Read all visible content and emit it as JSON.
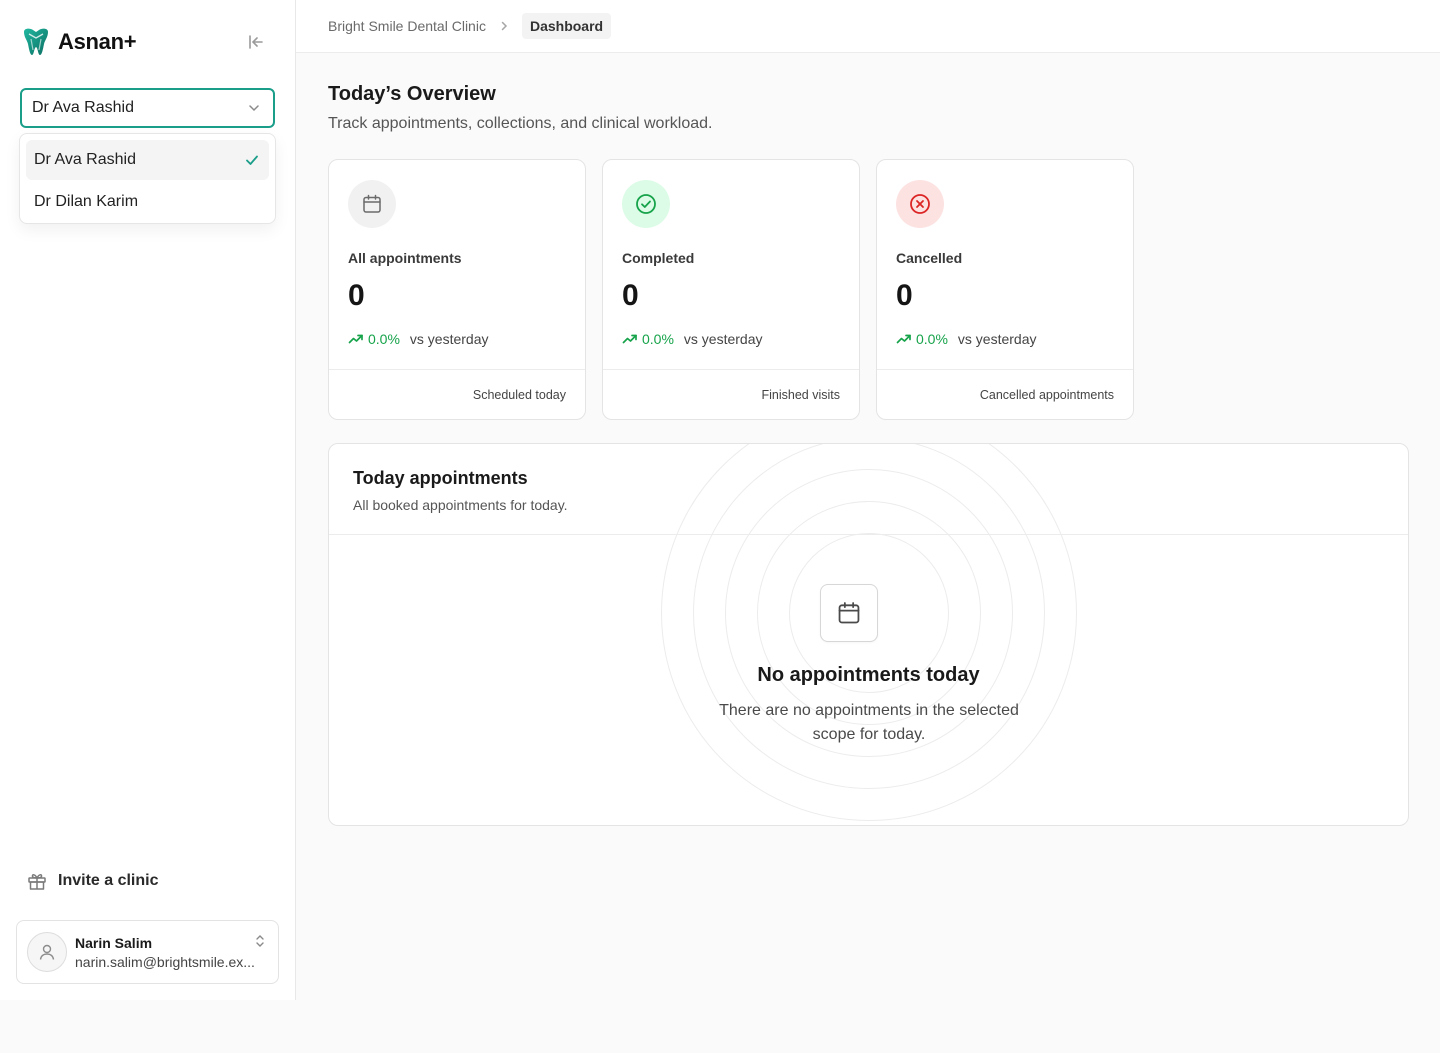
{
  "app": {
    "name": "Asnan+",
    "accent": "#1a9e8a"
  },
  "sidebar": {
    "doctor_select": {
      "value": "Dr Ava Rashid",
      "options": [
        "Dr Ava Rashid",
        "Dr Dilan Karim"
      ]
    },
    "invite_label": "Invite a clinic",
    "user": {
      "name": "Narin Salim",
      "email": "narin.salim@brightsmile.ex..."
    }
  },
  "breadcrumb": {
    "clinic": "Bright Smile Dental Clinic",
    "current": "Dashboard"
  },
  "overview": {
    "title": "Today’s Overview",
    "subtitle": "Track appointments, collections, and clinical workload.",
    "cards": [
      {
        "label": "All appointments",
        "value": "0",
        "trend": "0.0%",
        "trend_text": "vs yesterday",
        "footer": "Scheduled today",
        "icon": "calendar-icon",
        "icon_bg": "#f1f1f1"
      },
      {
        "label": "Completed",
        "value": "0",
        "trend": "0.0%",
        "trend_text": "vs yesterday",
        "footer": "Finished visits",
        "icon": "check-circle-icon",
        "icon_bg": "#dcfce7"
      },
      {
        "label": "Cancelled",
        "value": "0",
        "trend": "0.0%",
        "trend_text": "vs yesterday",
        "footer": "Cancelled appointments",
        "icon": "x-circle-icon",
        "icon_bg": "#fde2e2"
      }
    ]
  },
  "appointments": {
    "title": "Today appointments",
    "subtitle": "All booked appointments for today.",
    "empty_title": "No appointments today",
    "empty_text": "There are no appointments in the selected scope for today."
  }
}
